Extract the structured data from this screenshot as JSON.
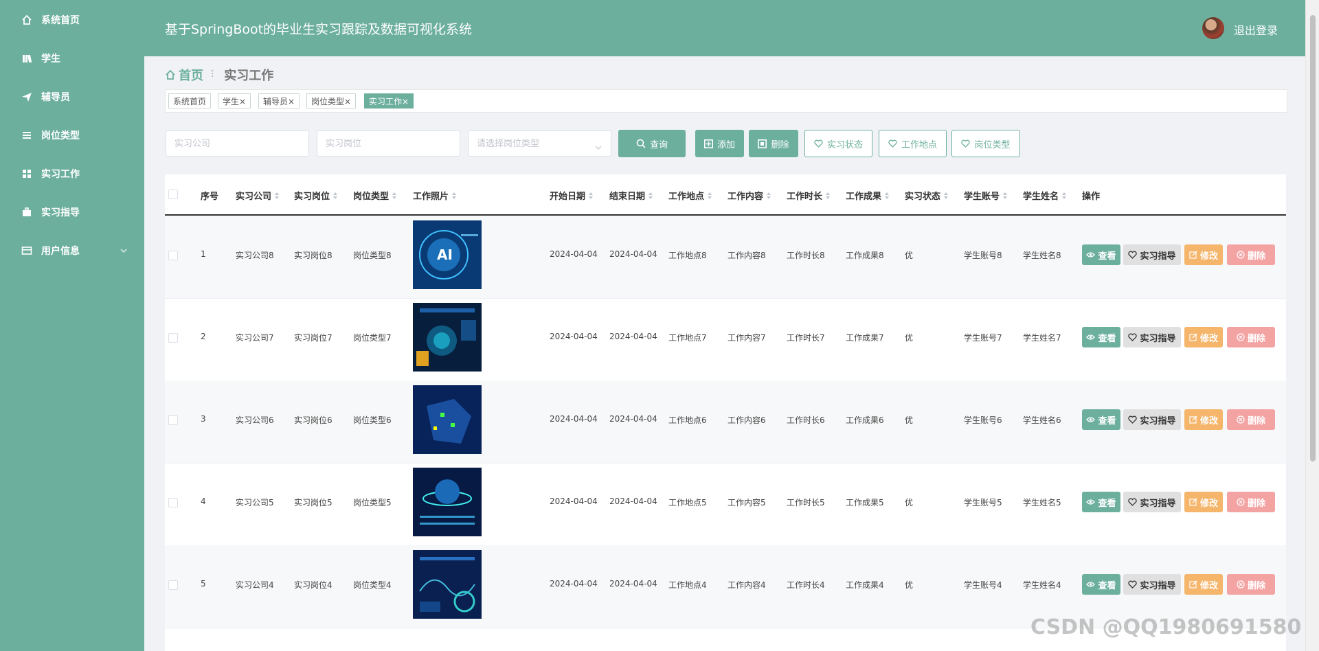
{
  "header": {
    "title": "基于SpringBoot的毕业生实习跟踪及数据可视化系统",
    "logout": "退出登录"
  },
  "sidebar": {
    "items": [
      {
        "label": "系统首页",
        "icon": "home-icon"
      },
      {
        "label": "学生",
        "icon": "book-icon"
      },
      {
        "label": "辅导员",
        "icon": "send-icon"
      },
      {
        "label": "岗位类型",
        "icon": "list-icon"
      },
      {
        "label": "实习工作",
        "icon": "grid-icon"
      },
      {
        "label": "实习指导",
        "icon": "briefcase-icon"
      },
      {
        "label": "用户信息",
        "icon": "card-icon"
      }
    ]
  },
  "breadcrumb": {
    "home": "首页",
    "current": "实习工作"
  },
  "tags": [
    {
      "label": "系统首页",
      "closable": false
    },
    {
      "label": "学生×",
      "closable": true
    },
    {
      "label": "辅导员×",
      "closable": true
    },
    {
      "label": "岗位类型×",
      "closable": true
    },
    {
      "label": "实习工作×",
      "closable": true,
      "active": true
    }
  ],
  "search": {
    "company_placeholder": "实习公司",
    "position_placeholder": "实习岗位",
    "type_placeholder": "请选择岗位类型",
    "query": "查询",
    "add": "添加",
    "delete": "删除",
    "stat_status": "实习状态",
    "stat_location": "工作地点",
    "stat_type": "岗位类型"
  },
  "table": {
    "headers": [
      "序号",
      "实习公司",
      "实习岗位",
      "岗位类型",
      "工作照片",
      "开始日期",
      "结束日期",
      "工作地点",
      "工作内容",
      "工作时长",
      "工作成果",
      "实习状态",
      "学生账号",
      "学生姓名",
      "操作"
    ],
    "actions": {
      "view": "查看",
      "guide": "实习指导",
      "edit": "修改",
      "delete": "删除"
    },
    "rows": [
      {
        "no": "1",
        "company": "实习公司8",
        "position": "实习岗位8",
        "type": "岗位类型8",
        "start": "2024-04-04",
        "end": "2024-04-04",
        "location": "工作地点8",
        "content": "工作内容8",
        "duration": "工作时长8",
        "result": "工作成果8",
        "status": "优",
        "account": "学生账号8",
        "name": "学生姓名8"
      },
      {
        "no": "2",
        "company": "实习公司7",
        "position": "实习岗位7",
        "type": "岗位类型7",
        "start": "2024-04-04",
        "end": "2024-04-04",
        "location": "工作地点7",
        "content": "工作内容7",
        "duration": "工作时长7",
        "result": "工作成果7",
        "status": "优",
        "account": "学生账号7",
        "name": "学生姓名7"
      },
      {
        "no": "3",
        "company": "实习公司6",
        "position": "实习岗位6",
        "type": "岗位类型6",
        "start": "2024-04-04",
        "end": "2024-04-04",
        "location": "工作地点6",
        "content": "工作内容6",
        "duration": "工作时长6",
        "result": "工作成果6",
        "status": "优",
        "account": "学生账号6",
        "name": "学生姓名6"
      },
      {
        "no": "4",
        "company": "实习公司5",
        "position": "实习岗位5",
        "type": "岗位类型5",
        "start": "2024-04-04",
        "end": "2024-04-04",
        "location": "工作地点5",
        "content": "工作内容5",
        "duration": "工作时长5",
        "result": "工作成果5",
        "status": "优",
        "account": "学生账号5",
        "name": "学生姓名5"
      },
      {
        "no": "5",
        "company": "实习公司4",
        "position": "实习岗位4",
        "type": "岗位类型4",
        "start": "2024-04-04",
        "end": "2024-04-04",
        "location": "工作地点4",
        "content": "工作内容4",
        "duration": "工作时长4",
        "result": "工作成果4",
        "status": "优",
        "account": "学生账号4",
        "name": "学生姓名4"
      }
    ]
  },
  "watermark": "CSDN @QQ1980691580",
  "colors": {
    "accent": "#6caf9d",
    "edit": "#f5b56a",
    "delete": "#f4a3a3"
  }
}
